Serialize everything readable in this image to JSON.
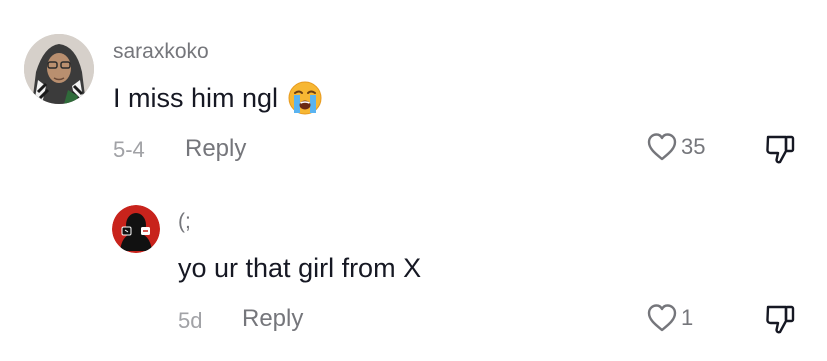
{
  "comments": [
    {
      "username": "saraxkoko",
      "text": "I miss him ngl",
      "emoji": "loudly-crying-face-emoji",
      "date": "5-4",
      "reply_label": "Reply",
      "likes": "35"
    },
    {
      "username": "(;",
      "text": "yo ur that girl from X",
      "date": "5d",
      "reply_label": "Reply",
      "likes": "1"
    }
  ],
  "icons": {
    "like": "heart-outline-icon",
    "dislike": "thumbs-down-outline-icon"
  },
  "colors": {
    "text_primary": "#161823",
    "text_secondary": "#75767b",
    "date": "#a1a2a6",
    "reply_avatar_bg": "#c8231c"
  }
}
